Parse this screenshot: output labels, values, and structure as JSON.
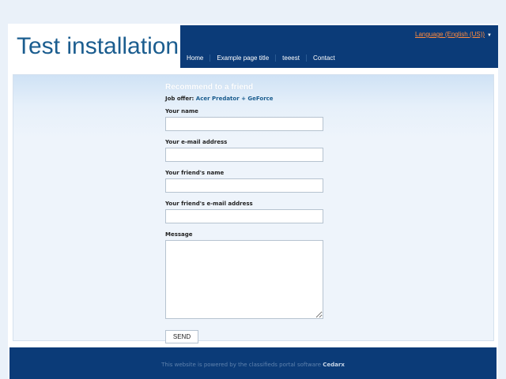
{
  "header": {
    "site_title": "Test installation",
    "language_label": "Language (English (US))"
  },
  "nav": {
    "items": [
      {
        "label": "Home"
      },
      {
        "label": "Example page title"
      },
      {
        "label": "teeest"
      },
      {
        "label": "Contact"
      }
    ]
  },
  "form": {
    "title": "Recommend to a friend",
    "job_offer_label": "Job offer:",
    "job_offer_value": "Acer Predator + GeForce",
    "fields": {
      "your_name": {
        "label": "Your name",
        "value": ""
      },
      "your_email": {
        "label": "Your e-mail address",
        "value": ""
      },
      "friend_name": {
        "label": "Your friend's name",
        "value": ""
      },
      "friend_email": {
        "label": "Your friend's e-mail address",
        "value": ""
      },
      "message": {
        "label": "Message",
        "value": ""
      }
    },
    "send_label": "SEND"
  },
  "footer": {
    "text": "This website is powered by the classifieds portal software",
    "brand": "Cedarx"
  },
  "colors": {
    "nav_bg": "#0b3b78",
    "title_color": "#1b5d8f",
    "lang_link": "#ff8a3d"
  }
}
